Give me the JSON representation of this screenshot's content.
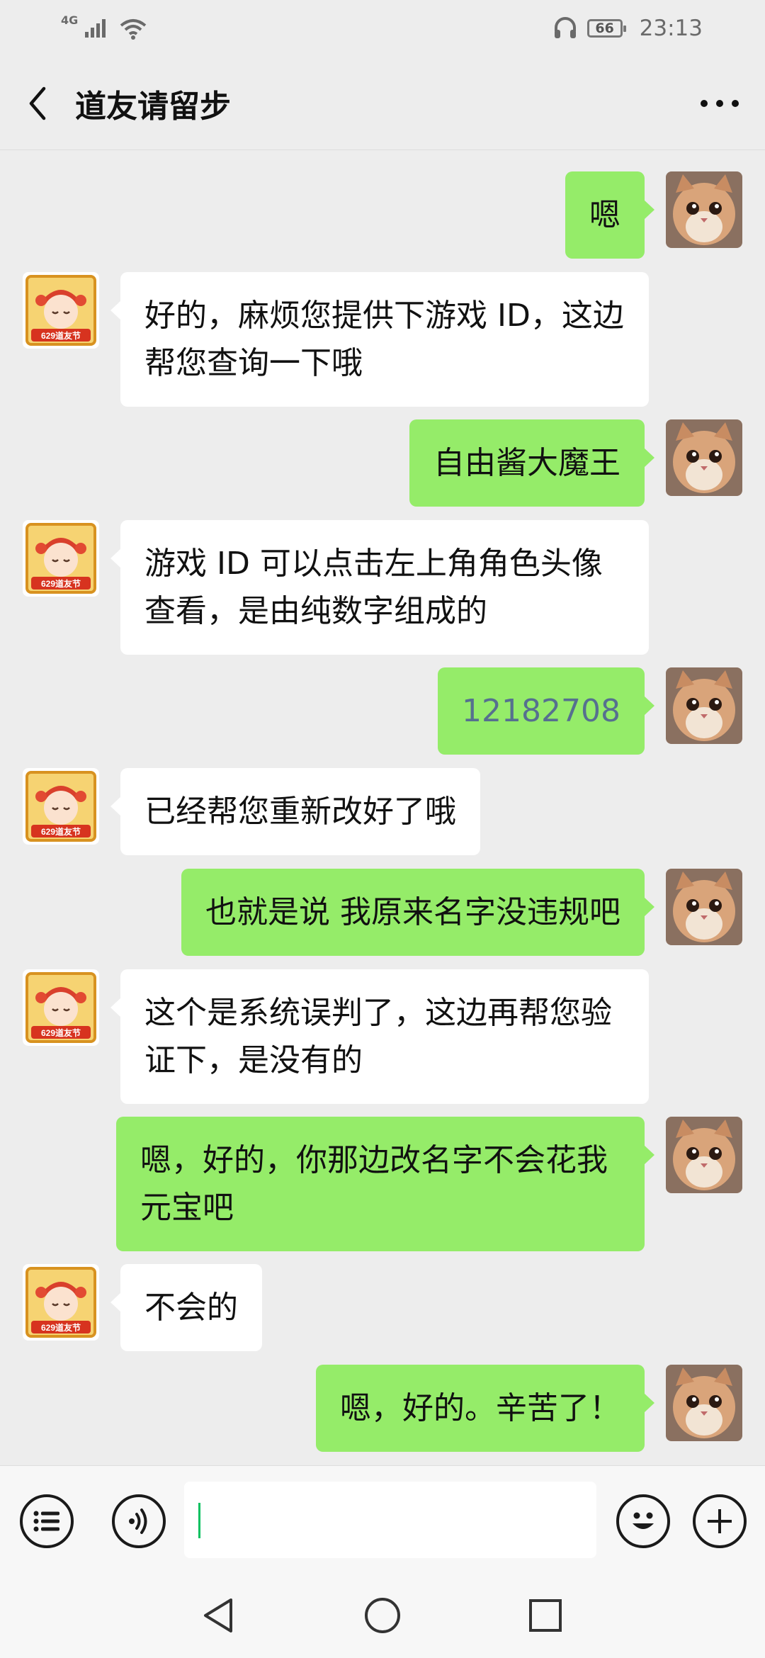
{
  "status_bar": {
    "network": "4G",
    "battery": "66",
    "time": "23:13"
  },
  "header": {
    "title": "道友请留步"
  },
  "messages": [
    {
      "side": "right",
      "text": "嗯"
    },
    {
      "side": "left",
      "text": "好的，麻烦您提供下游戏 ID，这边帮您查询一下哦"
    },
    {
      "side": "right",
      "text": "自由酱大魔王"
    },
    {
      "side": "left",
      "text": "游戏 ID 可以点击左上角角色头像查看，是由纯数字组成的"
    },
    {
      "side": "right",
      "text": "12182708"
    },
    {
      "side": "left",
      "text": "已经帮您重新改好了哦"
    },
    {
      "side": "right",
      "text": "也就是说 我原来名字没违规吧"
    },
    {
      "side": "left",
      "text": "这个是系统误判了，这边再帮您验证下，是没有的"
    },
    {
      "side": "right",
      "text": "嗯，好的，你那边改名字不会花我元宝吧"
    },
    {
      "side": "left",
      "text": "不会的"
    },
    {
      "side": "right",
      "text": "嗯，好的。辛苦了！"
    }
  ],
  "avatars": {
    "service_badge_text": "629道友节",
    "service_avatar_icon": "game-character-avatar",
    "user_avatar_icon": "cat-photo-avatar"
  },
  "input_bar": {
    "text_value": ""
  },
  "colors": {
    "background": "#ededed",
    "bubble_self": "#95ec69",
    "bubble_other": "#ffffff",
    "cursor": "#07c160"
  }
}
